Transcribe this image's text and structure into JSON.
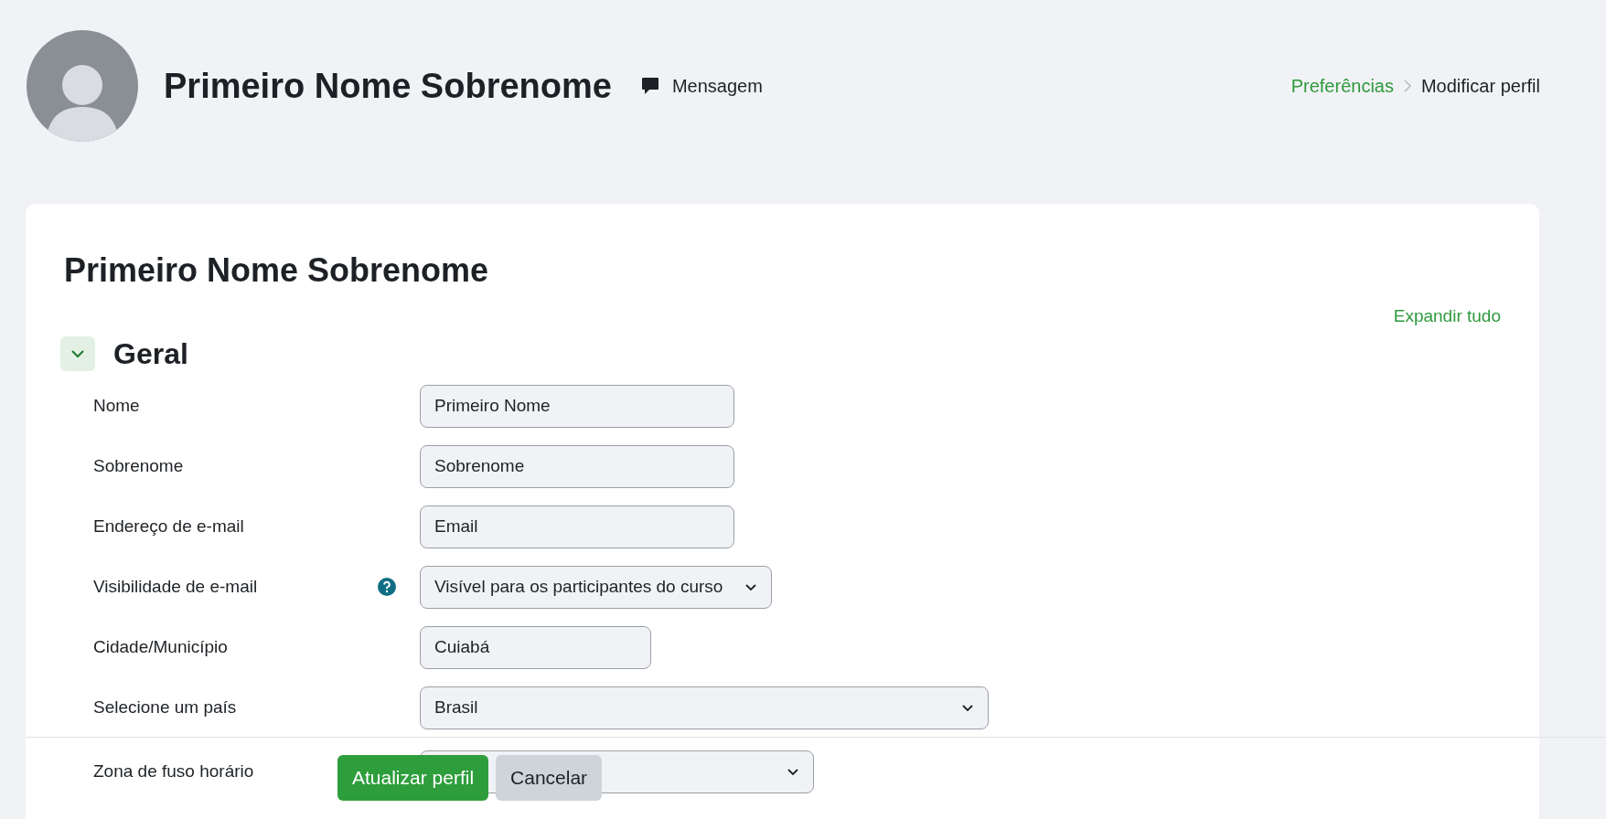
{
  "header": {
    "name": "Primeiro Nome Sobrenome",
    "message_link": "Mensagem"
  },
  "breadcrumb": [
    {
      "label": "Preferências",
      "link": true
    },
    {
      "label": "Modificar perfil",
      "link": false
    }
  ],
  "form": {
    "title": "Primeiro Nome Sobrenome",
    "expand_all": "Expandir tudo",
    "section": {
      "title": "Geral",
      "expanded": true
    },
    "fields": [
      {
        "label": "Nome",
        "kind": "text",
        "value": "Primeiro Nome",
        "help": false
      },
      {
        "label": "Sobrenome",
        "kind": "text",
        "value": "Sobrenome",
        "help": false
      },
      {
        "label": "Endereço de e-mail",
        "kind": "text",
        "value": "Email",
        "help": false
      },
      {
        "label": "Visibilidade de e-mail",
        "kind": "select",
        "value": "Visível para os participantes do curso",
        "help": true
      },
      {
        "label": "Cidade/Município",
        "kind": "text",
        "value": "Cuiabá",
        "help": false
      },
      {
        "label": "Selecione um país",
        "kind": "select",
        "value": "Brasil",
        "help": false
      },
      {
        "label": "Zona de fuso horário",
        "kind": "select",
        "help": false
      }
    ]
  },
  "footer_buttons": [
    {
      "label": "Atualizar perfil",
      "kind": "primary"
    },
    {
      "label": "Cancelar",
      "kind": "secondary"
    }
  ]
}
